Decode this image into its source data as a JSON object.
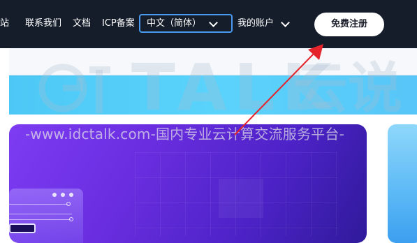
{
  "nav": {
    "partial_item": "站",
    "contact": "联系我们",
    "docs": "文档",
    "icp": "ICP备案",
    "language": "中文（简体）",
    "account": "我的账户",
    "signup": "免费注册"
  },
  "watermark": {
    "brand_latin": "TALK",
    "brand_cn": "云说",
    "slogan": "-www.idctalk.com-国内专业云计算交流服务平台-"
  },
  "colors": {
    "nav_bg": "#151d2b",
    "accent_blue": "#4a9af0",
    "arrow_red": "#e5232b",
    "hero_purple": "#6a2ee0",
    "banner_cyan": "#5ad3fb"
  }
}
